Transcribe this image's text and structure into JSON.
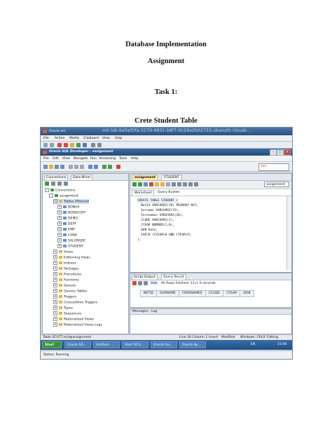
{
  "document": {
    "title": "Database Implementation",
    "subtitle": "Assignment",
    "task_heading": "Task 1:",
    "section_heading": "Crete Student Table"
  },
  "screenshot": {
    "vbox": {
      "title": "Oracle em",
      "url": "mil-lab-be5ef2fa-317d-4831-b8f7-0c29a2b02733.uksouth.clouds...",
      "menu": [
        "File",
        "Action",
        "Media",
        "Clipboard",
        "View",
        "Help"
      ]
    },
    "sqldev": {
      "title": "Oracle SQL Developer : assignment",
      "menu": [
        "File",
        "Edit",
        "View",
        "Navigate",
        "Run",
        "Versioning",
        "Tools",
        "Help"
      ],
      "search_text": "sea"
    },
    "left_pane": {
      "tabs": [
        "Connections",
        "Data Miner"
      ],
      "tree": [
        {
          "label": "Connections",
          "level": 0
        },
        {
          "label": "assignment",
          "level": 1
        },
        {
          "label": "Tables (Filtered)",
          "level": 2
        },
        {
          "label": "BONUS",
          "level": 3
        },
        {
          "label": "BOOKCOPY",
          "level": 3
        },
        {
          "label": "DEMO",
          "level": 3
        },
        {
          "label": "DEPT",
          "level": 3
        },
        {
          "label": "EMP",
          "level": 3
        },
        {
          "label": "LOAN",
          "level": 3
        },
        {
          "label": "SALGRADE",
          "level": 3
        },
        {
          "label": "STUDENT",
          "level": 3
        },
        {
          "label": "Views",
          "level": 2
        },
        {
          "label": "Editioning Views",
          "level": 2
        },
        {
          "label": "Indexes",
          "level": 2
        },
        {
          "label": "Packages",
          "level": 2
        },
        {
          "label": "Procedures",
          "level": 2
        },
        {
          "label": "Functions",
          "level": 2
        },
        {
          "label": "Queues",
          "level": 2
        },
        {
          "label": "Queues Tables",
          "level": 2
        },
        {
          "label": "Triggers",
          "level": 2
        },
        {
          "label": "Crossedition Triggers",
          "level": 2
        },
        {
          "label": "Types",
          "level": 2
        },
        {
          "label": "Sequences",
          "level": 2
        },
        {
          "label": "Materialized Views",
          "level": 2
        },
        {
          "label": "Materialized Views Logs",
          "level": 2
        }
      ]
    },
    "editor": {
      "tabs": [
        "assignment",
        "STUDENT"
      ],
      "connection": "assignment",
      "worksheet_tabs": [
        "Worksheet",
        "Query Builder"
      ],
      "code": [
        "CREATE TABLE STUDENT (",
        "  NetId VARCHAR2(20) PRIMARY KEY,",
        "  Surname VARCHAR2(15),",
        "  Forenames VARCHAR2(20),",
        "  CCODE VARCHAR2(1),",
        "  CYEAR NUMBER(1,0),",
        "  DOB Date,",
        "  CHECK (CYEAR>0 AND CYEAR<5)",
        ");"
      ]
    },
    "results": {
      "tabs": [
        "Script Output",
        "Query Result"
      ],
      "fetch_status": "All Rows Fetched: 13 in 0 seconds",
      "sql_label": "SQL",
      "columns": [
        "NETID",
        "SURNAME",
        "FORENAMES",
        "CCODE",
        "CYEAR",
        "DOB"
      ]
    },
    "messages": {
      "title": "Messages - Log"
    },
    "status_bar": {
      "left": "Table SCOTT.null@assignment",
      "position": "Line 30 Column 1",
      "mode": "Insert",
      "modified": "Modified",
      "platform": "Windows: CR/LF Editing"
    },
    "taskbar": {
      "start": "Start",
      "items": [
        "Oracle SQ...",
        "Untitled - ...",
        "Start OC4...",
        "Oracle For...",
        "Oracle Ap..."
      ],
      "lang": "EN",
      "clock": "21:06"
    },
    "vbox_status": "Status: Running"
  }
}
